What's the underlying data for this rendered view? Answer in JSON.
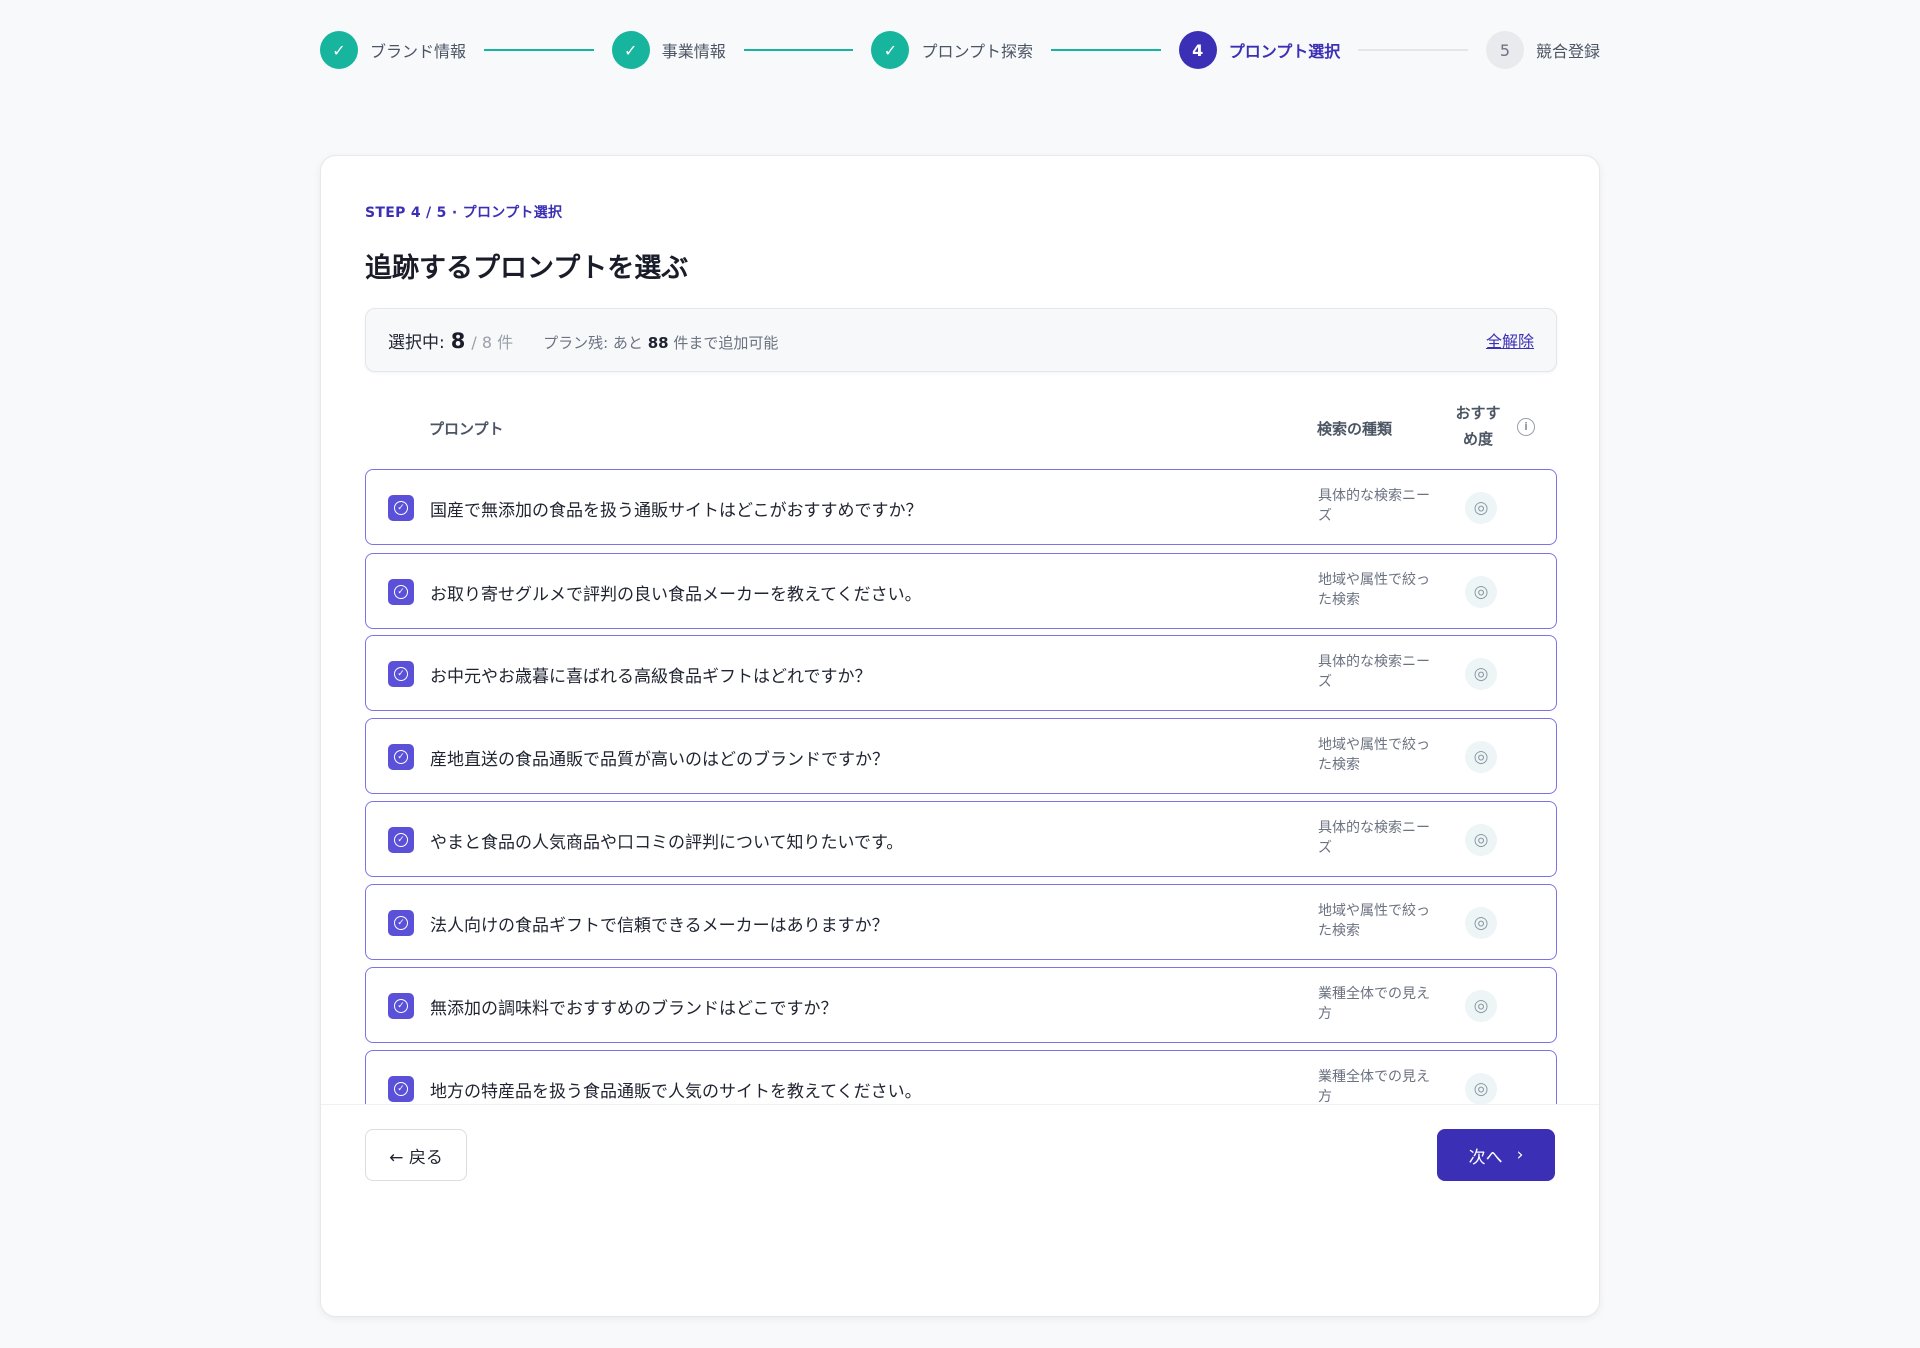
{
  "stepper": {
    "steps": [
      {
        "marker": "✓",
        "label": "ブランド情報",
        "state": "done"
      },
      {
        "marker": "✓",
        "label": "事業情報",
        "state": "done"
      },
      {
        "marker": "✓",
        "label": "プロンプト探索",
        "state": "done"
      },
      {
        "marker": "4",
        "label": "プロンプト選択",
        "state": "current"
      },
      {
        "marker": "5",
        "label": "競合登録",
        "state": "todo"
      }
    ]
  },
  "card": {
    "kicker": "STEP 4 / 5 · プロンプト選択",
    "title": "追跡するプロンプトを選ぶ"
  },
  "summary": {
    "selected_label": "選択中:",
    "selected_count": "8",
    "selected_total": "/ 8 件",
    "plan_prefix": "プラン残: あと",
    "plan_remaining": "88",
    "plan_suffix": "件まで追加可能",
    "clear_label": "全解除"
  },
  "table": {
    "headers": {
      "prompt": "プロンプト",
      "type": "検索の種類",
      "recommend": "おすすめ度",
      "info": "i"
    },
    "rows": [
      {
        "text": "国産で無添加の食品を扱う通販サイトはどこがおすすめですか？",
        "type": "具体的な検索ニーズ",
        "rec": "◎"
      },
      {
        "text": "お取り寄せグルメで評判の良い食品メーカーを教えてください。",
        "type": "地域や属性で絞った検索",
        "rec": "◎"
      },
      {
        "text": "お中元やお歳暮に喜ばれる高級食品ギフトはどれですか？",
        "type": "具体的な検索ニーズ",
        "rec": "◎"
      },
      {
        "text": "産地直送の食品通販で品質が高いのはどのブランドですか？",
        "type": "地域や属性で絞った検索",
        "rec": "◎"
      },
      {
        "text": "やまと食品の人気商品や口コミの評判について知りたいです。",
        "type": "具体的な検索ニーズ",
        "rec": "◎"
      },
      {
        "text": "法人向けの食品ギフトで信頼できるメーカーはありますか？",
        "type": "地域や属性で絞った検索",
        "rec": "◎"
      },
      {
        "text": "無添加の調味料でおすすめのブランドはどこですか？",
        "type": "業種全体での見え方",
        "rec": "◎"
      },
      {
        "text": "地方の特産品を扱う食品通販で人気のサイトを教えてください。",
        "type": "業種全体での見え方",
        "rec": "◎"
      }
    ]
  },
  "footer": {
    "back_label": "← 戻る",
    "next_label": "次へ",
    "next_icon": "›"
  }
}
